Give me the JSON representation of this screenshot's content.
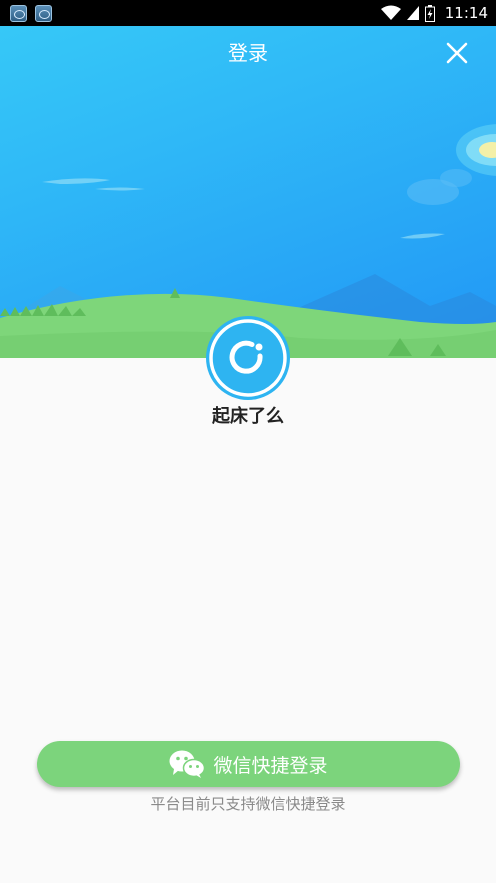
{
  "status_bar": {
    "time": "11:14",
    "icons": [
      "app-badge",
      "app-badge",
      "wifi-icon",
      "signal-icon",
      "battery-charging-icon"
    ]
  },
  "header": {
    "title": "登录",
    "close_icon": "close-icon"
  },
  "app": {
    "name": "起床了么",
    "logo_icon": "ring-logo-icon"
  },
  "login": {
    "wechat_button_label": "微信快捷登录",
    "wechat_icon": "wechat-icon",
    "hint": "平台目前只支持微信快捷登录"
  },
  "colors": {
    "banner_top": "#36c8f7",
    "banner_bottom": "#2196f5",
    "hill": "#7ed67a",
    "wechat_green": "#7cd47c",
    "logo_blue": "#2eb4f1"
  }
}
